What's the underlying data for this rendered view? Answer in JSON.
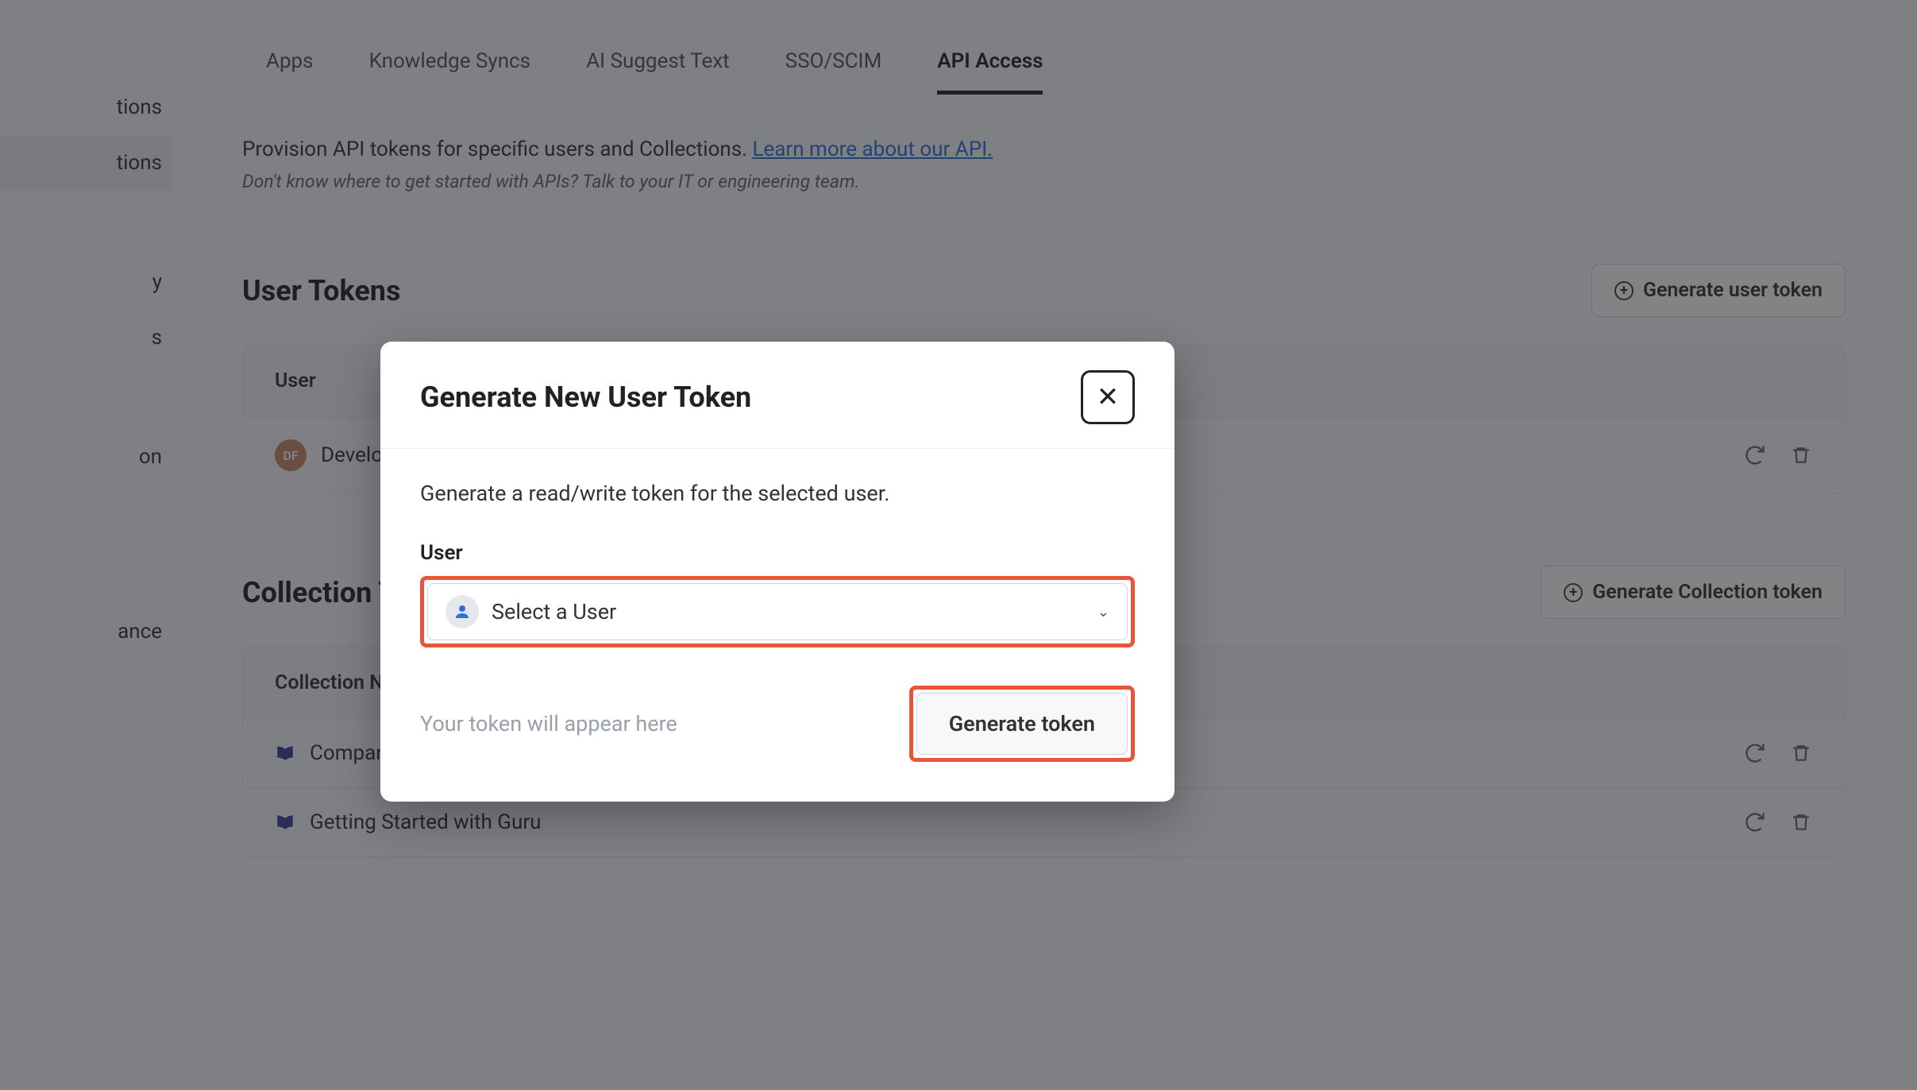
{
  "sidebar": {
    "items": [
      {
        "label": "tions"
      },
      {
        "label": "tions"
      },
      {
        "label": "y"
      },
      {
        "label": "s"
      },
      {
        "label": "on"
      },
      {
        "label": "ance"
      }
    ]
  },
  "tabs": [
    {
      "label": "Apps",
      "active": false
    },
    {
      "label": "Knowledge Syncs",
      "active": false
    },
    {
      "label": "AI Suggest Text",
      "active": false
    },
    {
      "label": "SSO/SCIM",
      "active": false
    },
    {
      "label": "API Access",
      "active": true
    }
  ],
  "intro": {
    "text": "Provision API tokens for specific users and Collections. ",
    "link": "Learn more about our API.",
    "note": "Don't know where to get started with APIs? Talk to your IT or engineering team."
  },
  "userTokens": {
    "title": "User Tokens",
    "generateBtn": "Generate user token",
    "header": "User",
    "rows": [
      {
        "avatar": "DF",
        "name": "Develop"
      }
    ]
  },
  "collectionTokens": {
    "title": "Collection T",
    "generateBtn": "Generate Collection token",
    "header": "Collection Na",
    "rows": [
      {
        "name": "Compan"
      },
      {
        "name": "Getting Started with Guru"
      }
    ]
  },
  "modal": {
    "title": "Generate New User Token",
    "desc": "Generate a read/write token for the selected user.",
    "fieldLabel": "User",
    "selectPlaceholder": "Select a User",
    "tokenHint": "Your token will appear here",
    "generateBtn": "Generate token"
  }
}
